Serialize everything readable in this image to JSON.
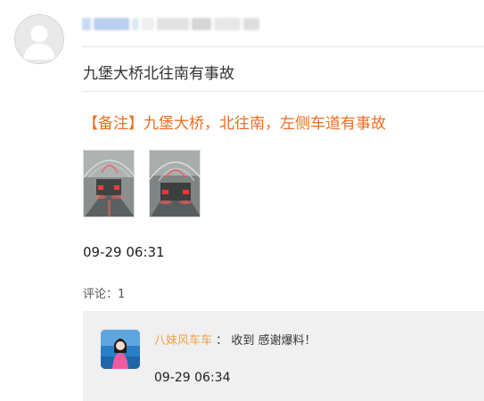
{
  "post": {
    "title": "九堡大桥北往南有事故",
    "note": "【备注】九堡大桥，北往南，左侧车道有事故",
    "images": [
      {
        "label": "事故现场照片1"
      },
      {
        "label": "事故现场照片2"
      }
    ],
    "time": "09-29 06:31",
    "comment_count_label": "评论：1"
  },
  "reply": {
    "user": "八妹风车车",
    "separator": "：",
    "text": "收到 感谢爆料！",
    "time": "09-29 06:34"
  },
  "colors": {
    "note": "#ef6c21",
    "reply_user": "#f0a04a",
    "reply_background": "#f0f0f0"
  },
  "icons": {
    "poster_avatar": "default-person-avatar-icon",
    "reply_avatar": "user-photo-avatar"
  }
}
